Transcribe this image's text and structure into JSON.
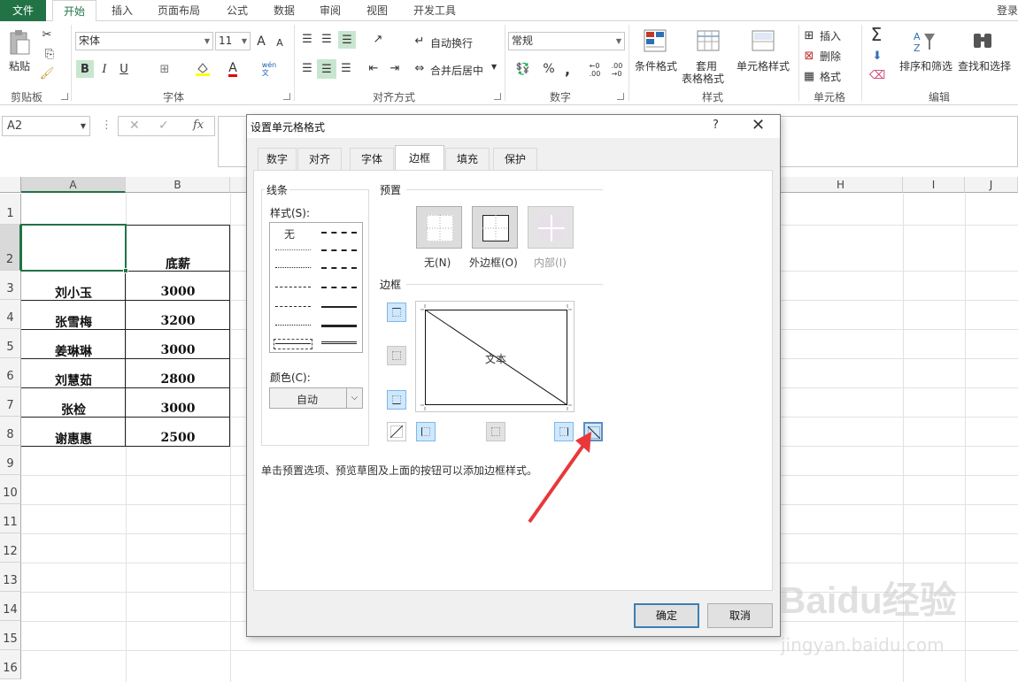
{
  "ribbon": {
    "tabs": [
      "文件",
      "开始",
      "插入",
      "页面布局",
      "公式",
      "数据",
      "审阅",
      "视图",
      "开发工具"
    ],
    "login": "登录",
    "clipboard": {
      "paste": "粘贴",
      "label": "剪贴板"
    },
    "font": {
      "name": "宋体",
      "size": "11",
      "bold": "B",
      "italic": "I",
      "underline": "U",
      "grow": "A",
      "shrink": "A",
      "color_a": "A",
      "wen": "wén\n文",
      "label": "字体"
    },
    "align": {
      "wrap": "自动换行",
      "merge": "合并后居中",
      "label": "对齐方式"
    },
    "number": {
      "format": "常规",
      "percent": "%",
      "comma": ",",
      "inc": "←0\n.00",
      "dec": ".00\n→0",
      "label": "数字"
    },
    "styles": {
      "cond": "条件格式",
      "table_line1": "套用",
      "table_line2": "表格格式",
      "cell": "单元格样式",
      "label": "样式"
    },
    "cells": {
      "insert": "插入",
      "delete": "删除",
      "format": "格式",
      "label": "单元格"
    },
    "edit": {
      "sort": "排序和筛选",
      "find": "查找和选择",
      "sigma": "Σ",
      "label": "编辑"
    }
  },
  "formula_bar": {
    "name_box": "A2",
    "cancel": "✕",
    "enter": "✓",
    "fx": "fx",
    "more": "⋮"
  },
  "sheet": {
    "columns": [
      "A",
      "B",
      "H",
      "I",
      "J"
    ],
    "rows": [
      "1",
      "2",
      "3",
      "4",
      "5",
      "6",
      "7",
      "8",
      "9",
      "10",
      "11",
      "12",
      "13",
      "14",
      "15",
      "16"
    ],
    "header_b2": "底薪",
    "names": [
      "刘小玉",
      "张雪梅",
      "姜琳琳",
      "刘慧茹",
      "张检",
      "谢惠惠"
    ],
    "salaries": [
      "3000",
      "3200",
      "3000",
      "2800",
      "3000",
      "2500"
    ]
  },
  "dialog": {
    "title": "设置单元格格式",
    "help": "?",
    "close": "✕",
    "tabs": [
      "数字",
      "对齐",
      "字体",
      "边框",
      "填充",
      "保护"
    ],
    "active_tab": "边框",
    "line_section": "线条",
    "style_label": "样式(S):",
    "style_none": "无",
    "color_label": "颜色(C):",
    "color_value": "自动",
    "presets_label": "预置",
    "presets": [
      "无(N)",
      "外边框(O)",
      "内部(I)"
    ],
    "border_label": "边框",
    "preview_text": "文本",
    "hint": "单击预置选项、预览草图及上面的按钮可以添加边框样式。",
    "ok": "确定",
    "cancel": "取消"
  },
  "watermark": {
    "brand": "Baidu经验",
    "url": "jingyan.baidu.com"
  },
  "colors": {
    "excel_green": "#217346",
    "selection_blue": "#cde8ff",
    "arrow_red": "#e8383b"
  }
}
